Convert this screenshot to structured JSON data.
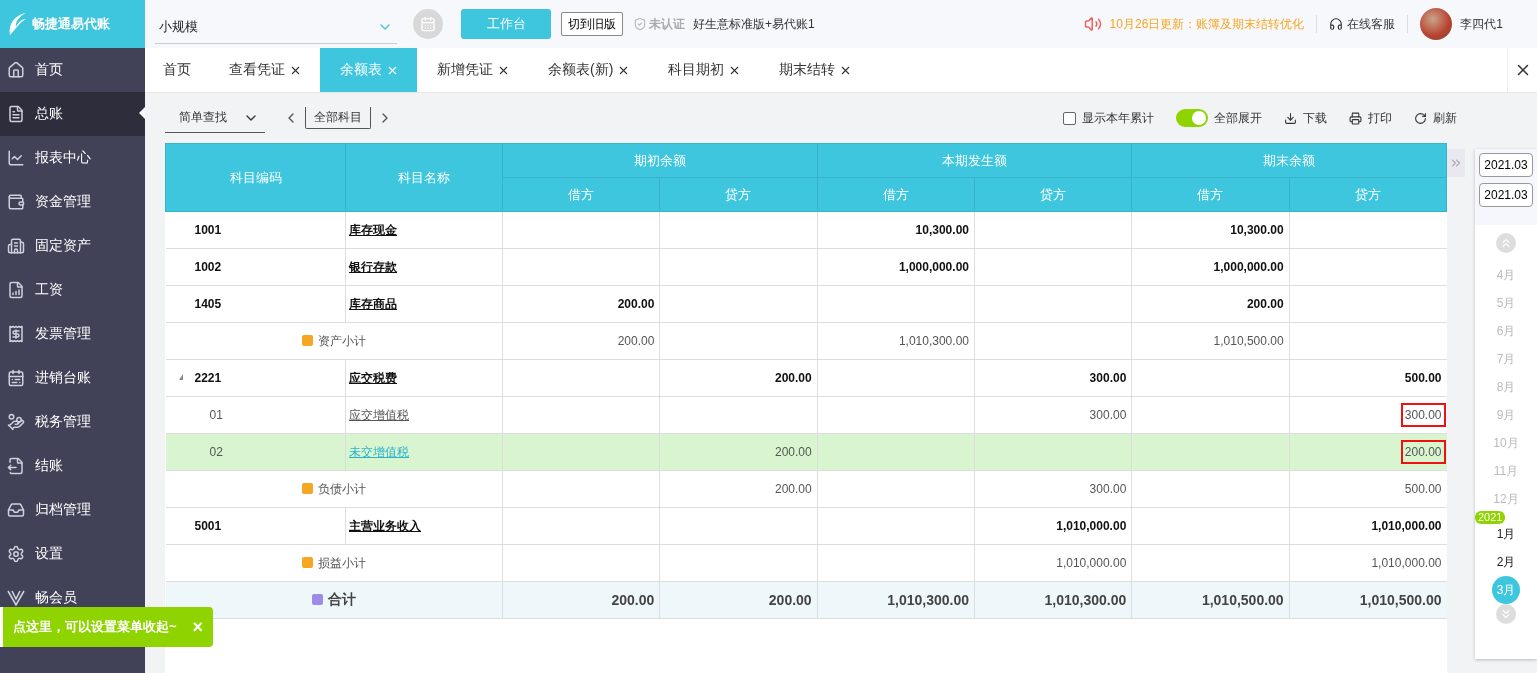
{
  "brand": {
    "name": "畅捷通易代账"
  },
  "header": {
    "company": "小规模",
    "workbench_button": "工作台",
    "old_version_button": "切到旧版",
    "certification": "未认证",
    "product": "好生意标准版+易代账1",
    "notice": "10月26日更新：账簿及期末结转优化",
    "support": "在线客服",
    "user": "李四代1"
  },
  "sidebar": {
    "items": [
      {
        "label": "首页",
        "selected": false
      },
      {
        "label": "总账",
        "selected": true
      },
      {
        "label": "报表中心",
        "selected": false
      },
      {
        "label": "资金管理",
        "selected": false
      },
      {
        "label": "固定资产",
        "selected": false
      },
      {
        "label": "工资",
        "selected": false
      },
      {
        "label": "发票管理",
        "selected": false
      },
      {
        "label": "进销台账",
        "selected": false
      },
      {
        "label": "税务管理",
        "selected": false
      },
      {
        "label": "结账",
        "selected": false
      },
      {
        "label": "归档管理",
        "selected": false
      },
      {
        "label": "设置",
        "selected": false
      },
      {
        "label": "畅会员",
        "selected": false
      }
    ]
  },
  "tip": {
    "text": "点这里，可以设置菜单收起~",
    "close": "×"
  },
  "tabs": [
    {
      "label": "首页",
      "closable": false,
      "selected": false
    },
    {
      "label": "查看凭证",
      "closable": true,
      "selected": false
    },
    {
      "label": "余额表",
      "closable": true,
      "selected": true
    },
    {
      "label": "新增凭证",
      "closable": true,
      "selected": false
    },
    {
      "label": "余额表(新)",
      "closable": true,
      "selected": false
    },
    {
      "label": "科目期初",
      "closable": true,
      "selected": false
    },
    {
      "label": "期末结转",
      "closable": true,
      "selected": false
    }
  ],
  "toolbar": {
    "search_mode": "简单查找",
    "subject_filter": "全部科目",
    "show_year_total": {
      "label": "显示本年累计",
      "checked": false
    },
    "expand_all": {
      "label": "全部展开",
      "on": true
    },
    "download": "下载",
    "print": "打印",
    "refresh": "刷新"
  },
  "table": {
    "columns": [
      "科目编码",
      "科目名称"
    ],
    "groups": [
      {
        "label": "期初余额",
        "sub": [
          "借方",
          "贷方"
        ]
      },
      {
        "label": "本期发生额",
        "sub": [
          "借方",
          "贷方"
        ]
      },
      {
        "label": "期末余额",
        "sub": [
          "借方",
          "贷方"
        ]
      }
    ],
    "rows": [
      {
        "kind": "account",
        "code": "1001",
        "name": "库存现金",
        "selected": false,
        "values": {
          "period_debit": {
            "text": "10,300.00",
            "outlined": false
          },
          "closing_debit": {
            "text": "10,300.00",
            "outlined": false
          }
        }
      },
      {
        "kind": "account",
        "code": "1002",
        "name": "银行存款",
        "selected": false,
        "values": {
          "period_debit": {
            "text": "1,000,000.00",
            "outlined": false
          },
          "closing_debit": {
            "text": "1,000,000.00",
            "outlined": false
          }
        }
      },
      {
        "kind": "account",
        "code": "1405",
        "name": "库存商品",
        "selected": false,
        "values": {
          "opening_debit": {
            "text": "200.00",
            "outlined": false
          },
          "closing_debit": {
            "text": "200.00",
            "outlined": false
          }
        }
      },
      {
        "kind": "subtotal",
        "name": "资产小计",
        "selected": false,
        "values": {
          "opening_debit": {
            "text": "200.00",
            "outlined": false
          },
          "period_debit": {
            "text": "1,010,300.00",
            "outlined": false
          },
          "closing_debit": {
            "text": "1,010,500.00",
            "outlined": false
          }
        }
      },
      {
        "kind": "account",
        "code": "2221",
        "name": "应交税费",
        "expanded": true,
        "selected": false,
        "values": {
          "opening_credit": {
            "text": "200.00",
            "outlined": false
          },
          "period_credit": {
            "text": "300.00",
            "outlined": false
          },
          "closing_credit": {
            "text": "500.00",
            "outlined": false
          }
        }
      },
      {
        "kind": "child",
        "code": "01",
        "name": "应交增值税",
        "selected": false,
        "values": {
          "period_credit": {
            "text": "300.00",
            "outlined": false
          },
          "closing_credit": {
            "text": "300.00",
            "outlined": true
          }
        }
      },
      {
        "kind": "child",
        "code": "02",
        "name": "未交增值税",
        "selected": true,
        "values": {
          "opening_credit": {
            "text": "200.00",
            "outlined": false
          },
          "closing_credit": {
            "text": "200.00",
            "outlined": true
          }
        }
      },
      {
        "kind": "subtotal",
        "name": "负债小计",
        "selected": false,
        "values": {
          "opening_credit": {
            "text": "200.00",
            "outlined": false
          },
          "period_credit": {
            "text": "300.00",
            "outlined": false
          },
          "closing_credit": {
            "text": "500.00",
            "outlined": false
          }
        }
      },
      {
        "kind": "account",
        "code": "5001",
        "name": "主营业务收入",
        "selected": false,
        "values": {
          "period_credit": {
            "text": "1,010,000.00",
            "outlined": false
          },
          "closing_credit": {
            "text": "1,010,000.00",
            "outlined": false
          }
        }
      },
      {
        "kind": "subtotal",
        "name": "损益小计",
        "selected": false,
        "values": {
          "period_credit": {
            "text": "1,010,000.00",
            "outlined": false
          },
          "closing_credit": {
            "text": "1,010,000.00",
            "outlined": false
          }
        }
      },
      {
        "kind": "total",
        "name": "合计",
        "selected": false,
        "values": {
          "opening_debit": {
            "text": "200.00",
            "outlined": false
          },
          "opening_credit": {
            "text": "200.00",
            "outlined": false
          },
          "period_debit": {
            "text": "1,010,300.00",
            "outlined": false
          },
          "period_credit": {
            "text": "1,010,300.00",
            "outlined": false
          },
          "closing_debit": {
            "text": "1,010,500.00",
            "outlined": false
          },
          "closing_credit": {
            "text": "1,010,500.00",
            "outlined": false
          }
        }
      }
    ]
  },
  "period": {
    "start": "2021.03",
    "end": "2021.03",
    "year_badge": "2021",
    "months": [
      {
        "label": "4月",
        "disabled": true,
        "selected": false
      },
      {
        "label": "5月",
        "disabled": true,
        "selected": false
      },
      {
        "label": "6月",
        "disabled": true,
        "selected": false
      },
      {
        "label": "7月",
        "disabled": true,
        "selected": false
      },
      {
        "label": "8月",
        "disabled": true,
        "selected": false
      },
      {
        "label": "9月",
        "disabled": true,
        "selected": false
      },
      {
        "label": "10月",
        "disabled": true,
        "selected": false
      },
      {
        "label": "11月",
        "disabled": true,
        "selected": false
      },
      {
        "label": "12月",
        "disabled": true,
        "selected": false
      },
      {
        "label": "1月",
        "disabled": false,
        "selected": false
      },
      {
        "label": "2月",
        "disabled": false,
        "selected": false
      },
      {
        "label": "3月",
        "disabled": false,
        "selected": true
      }
    ]
  }
}
